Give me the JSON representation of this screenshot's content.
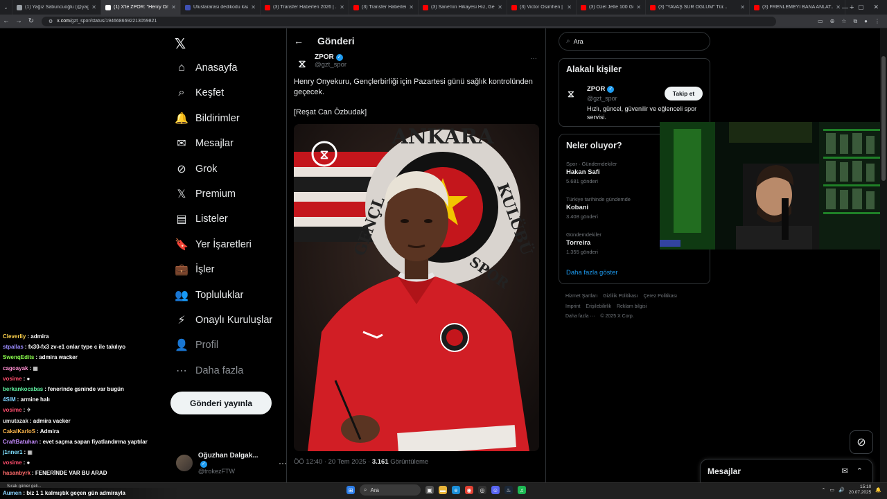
{
  "browser": {
    "tabs": [
      {
        "label": "(1) Yağız Sabuncuoğlu (@yagiz...",
        "color": "#9aa0a6",
        "active": false
      },
      {
        "label": "(1) X'te ZPOR: \"Henry Onyeku...",
        "color": "#ffffff",
        "active": true
      },
      {
        "label": "Uluslararası dedikodu kazanı",
        "color": "#3f51b5",
        "active": false
      },
      {
        "label": "(3) Transfer Haberleri 2026 | ...",
        "color": "#ff0000",
        "active": false
      },
      {
        "label": "(3) Transfer Haberleri 2026 ...",
        "color": "#ff0000",
        "active": false
      },
      {
        "label": "(3) Sane'nin Hikayesi Hız, Gen...",
        "color": "#ff0000",
        "active": false
      },
      {
        "label": "(3) Victor Osimhen | 7. Çocuk...",
        "color": "#ff0000",
        "active": false
      },
      {
        "label": "(3) Özel Jette 100 Gün Tutsak...",
        "color": "#ff0000",
        "active": false
      },
      {
        "label": "(3) \"YAVAŞ SÜR OĞLUM\" Tür...",
        "color": "#ff0000",
        "active": false
      },
      {
        "label": "(3) FRENLEMEYİ BANA ANLAT...",
        "color": "#ff0000",
        "active": false
      }
    ],
    "new_tab": "+",
    "url_domain": "x.com",
    "url_path": "/gzt_spor/status/1946686692213059821"
  },
  "nav": {
    "items": [
      {
        "label": "Anasayfa",
        "icon": "⌂",
        "name": "home"
      },
      {
        "label": "Keşfet",
        "icon": "⌕",
        "name": "explore"
      },
      {
        "label": "Bildirimler",
        "icon": "🔔",
        "name": "notifications"
      },
      {
        "label": "Mesajlar",
        "icon": "✉",
        "name": "messages"
      },
      {
        "label": "Grok",
        "icon": "⊘",
        "name": "grok"
      },
      {
        "label": "Premium",
        "icon": "𝕏",
        "name": "premium"
      },
      {
        "label": "Listeler",
        "icon": "▤",
        "name": "lists"
      },
      {
        "label": "Yer İşaretleri",
        "icon": "🔖",
        "name": "bookmarks"
      },
      {
        "label": "İşler",
        "icon": "💼",
        "name": "jobs"
      },
      {
        "label": "Topluluklar",
        "icon": "👥",
        "name": "communities"
      },
      {
        "label": "Onaylı Kuruluşlar",
        "icon": "⚡",
        "name": "verified-orgs"
      },
      {
        "label": "Profil",
        "icon": "👤",
        "name": "profile"
      },
      {
        "label": "Daha fazla",
        "icon": "⋯",
        "name": "more"
      }
    ],
    "post_button": "Gönderi yayınla",
    "account_name": "Oğuzhan Dalgak...",
    "account_handle": "@trokezFTW"
  },
  "chat": [
    {
      "user": "Cleverliy",
      "color": "#ffd34d",
      "msg": "admira"
    },
    {
      "user": "stpallas",
      "color": "#9b8cff",
      "msg": "fx30-fx3 zv-e1 onlar type c ile takılıyo"
    },
    {
      "user": "SwenqEdits",
      "color": "#8cff4d",
      "msg": "admira wacker"
    },
    {
      "user": "cagoayak",
      "color": "#ff8fd1",
      "msg": "▦"
    },
    {
      "user": "vosime",
      "color": "#ff4d6d",
      "msg": "●"
    },
    {
      "user": "berkankocabas",
      "color": "#5ef0a0",
      "msg": "fenerinde gsninde var bugün"
    },
    {
      "user": "4SIM",
      "color": "#7fd4ff",
      "msg": "armine halı"
    },
    {
      "user": "vosime",
      "color": "#ff4d6d",
      "msg": "✈"
    },
    {
      "user": "umutazak",
      "color": "#e0e0e0",
      "msg": "admira vacker"
    },
    {
      "user": "CakalKarloS",
      "color": "#ffb84d",
      "msg": "Admira"
    },
    {
      "user": "CraftBatuhan",
      "color": "#c58cff",
      "msg": "evet saçma sapan fiyatlandırma yaptılar"
    },
    {
      "user": "j1nner1",
      "color": "#7fe0ff",
      "msg": "▦"
    },
    {
      "user": "vosime",
      "color": "#ff4d6d",
      "msg": "●"
    },
    {
      "user": "hasanbyrk",
      "color": "#ff6b6b",
      "msg": "FENERİNDE VAR BU ARAD"
    }
  ],
  "last_chat": {
    "user": "Aumen",
    "color": "#8cd4ff",
    "msg": "biz 1 1 kalmıştık geçen gün admirayla"
  },
  "main": {
    "header_title": "Gönderi",
    "author_name": "ZPOR",
    "author_handle": "@gzt_spor",
    "tweet_text": "Henry Onyekuru, Gençlerbirliği için Pazartesi günü sağlık kontrolünden geçecek.",
    "tweet_credit": "[Reşat Can Özbudak]",
    "time": "ÖÖ 12:40 · 20 Tem 2025 · ",
    "views_count": "3.161",
    "views_label": " Görüntüleme",
    "crest_top": "ANKARA",
    "crest_left": "GENÇL",
    "crest_right": "KULÜBÜ",
    "crest_bottom": "SPOR"
  },
  "right": {
    "search_placeholder": "Ara",
    "related_title": "Alakalı kişiler",
    "related_name": "ZPOR",
    "related_handle": "@gzt_spor",
    "related_bio": "Hızlı, güncel, güvenilir ve eğlenceli spor servisi.",
    "follow_label": "Takip et",
    "trends_title": "Neler oluyor?",
    "trends": [
      {
        "context": "Spor · Gündemdekiler",
        "name": "Hakan Safi",
        "posts": "5.681 gönderi"
      },
      {
        "context": "Türkiye tarihinde gündemde",
        "name": "Kobani",
        "posts": "3.408 gönderi"
      },
      {
        "context": "Gündemdekiler",
        "name": "Torreira",
        "posts": "1.355 gönderi"
      }
    ],
    "show_more": "Daha fazla göster",
    "footer": [
      "Hizmet Şartları",
      "Gizlilik Politikası",
      "Çerez Politikası",
      "Imprint",
      "Erişilebilirlik",
      "Reklam bilgisi",
      "Daha fazla ···",
      "© 2025 X Corp."
    ]
  },
  "messages_label": "Mesajlar",
  "taskbar": {
    "weather": "Sıcak günler geli...",
    "search": "Ara",
    "time": "15:10",
    "date": "20.07.2025"
  }
}
